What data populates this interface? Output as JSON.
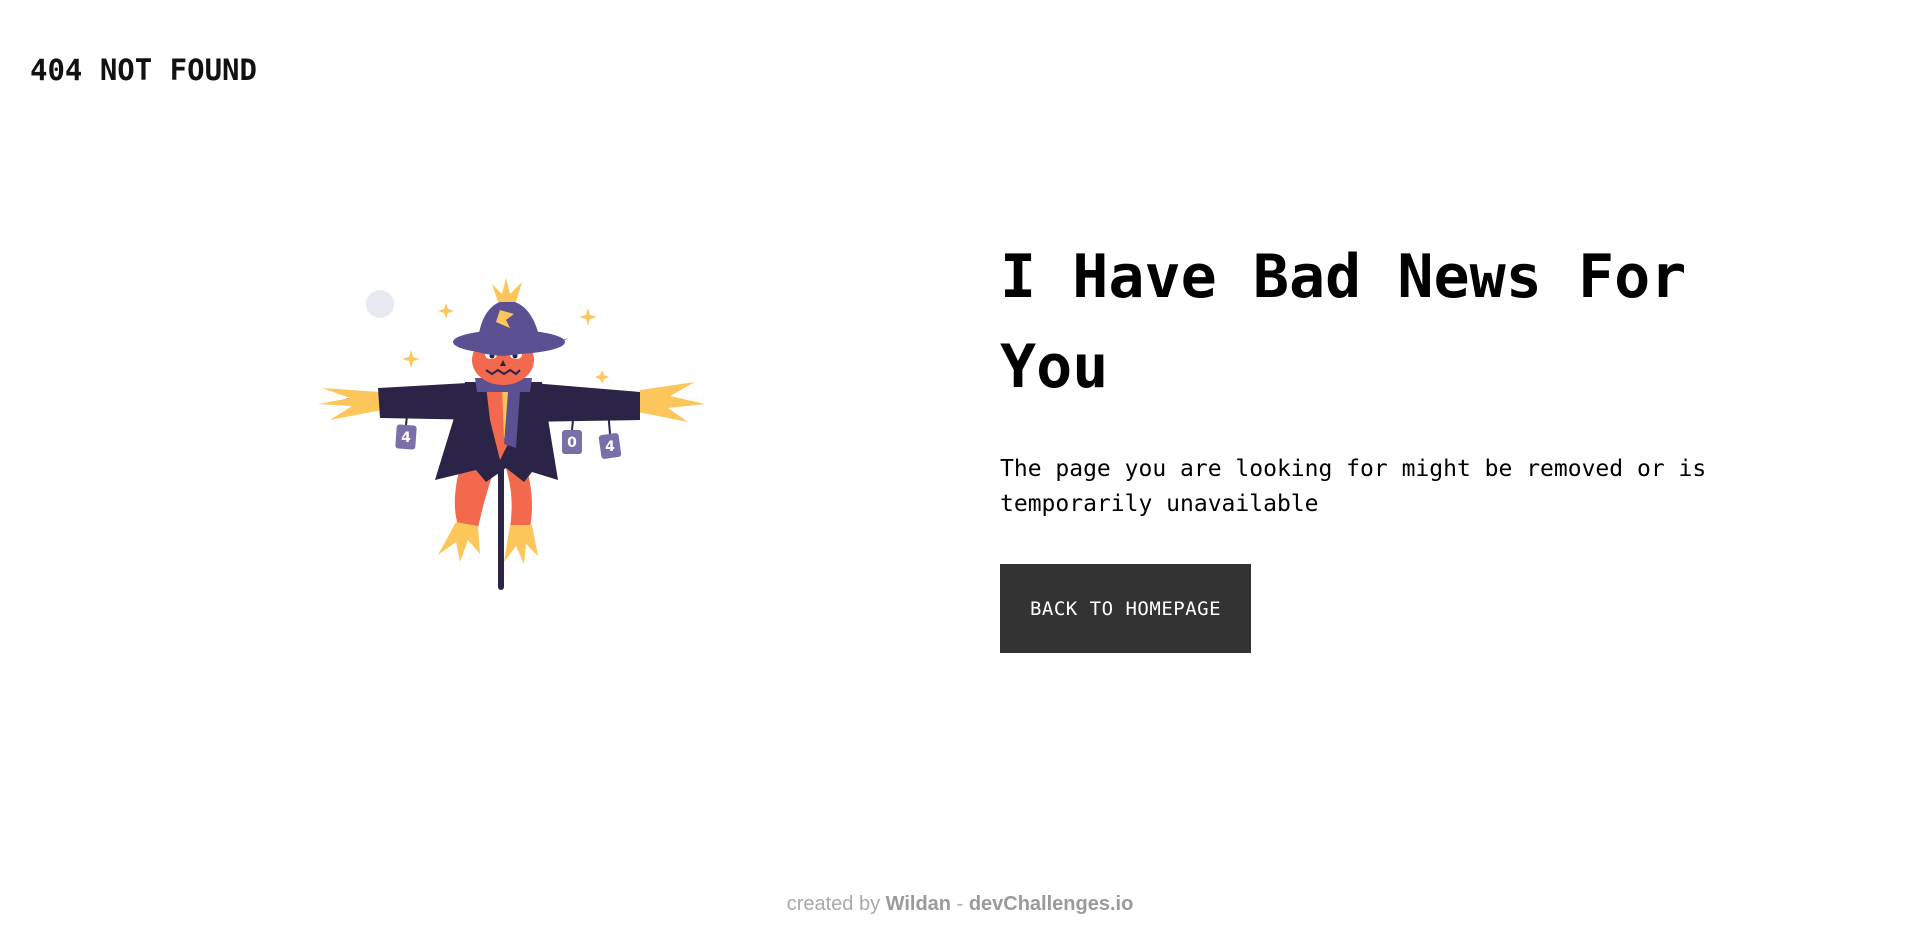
{
  "header": {
    "brand": "404 NOT FOUND"
  },
  "illustration": {
    "icon": "scarecrow-illustration",
    "can_labels": [
      "4",
      "0",
      "4"
    ]
  },
  "main": {
    "headline": "I Have Bad News For You",
    "description": "The page you are looking for might be removed or is temporarily unavailable",
    "button_label": "BACK TO HOMEPAGE"
  },
  "footer": {
    "prefix": "created by",
    "author": "Wildan",
    "separator": "-",
    "site": "devChallenges.io"
  },
  "colors": {
    "background": "#ffffff",
    "text": "#000000",
    "button_bg": "#333333",
    "button_text": "#ffffff",
    "footer_text": "#a9a9a9",
    "scarecrow_coat": "#2c2447",
    "scarecrow_hat": "#5a5092",
    "scarecrow_head": "#f3694d",
    "straw": "#fcc65b",
    "moon": "#e8eaf2"
  }
}
